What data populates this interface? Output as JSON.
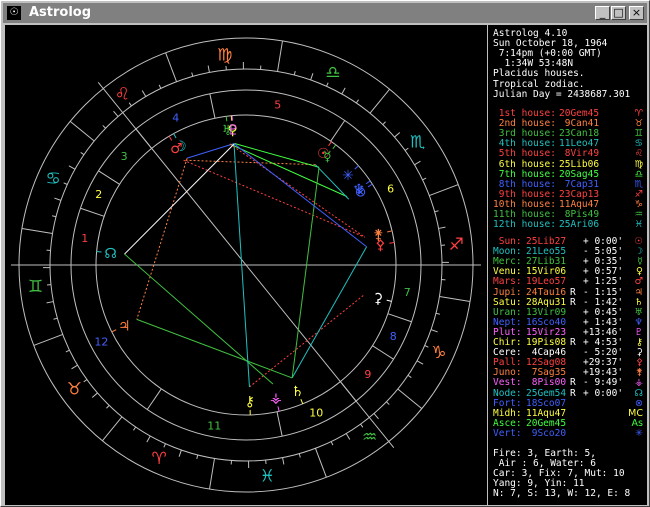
{
  "window": {
    "title": "Astrolog",
    "icon": "astrolog-app-icon",
    "controls": {
      "minimize": "_",
      "maximize": "□",
      "close": "×"
    }
  },
  "header": [
    "Astrolog 4.10",
    "Sun October 18, 1964",
    " 7:14pm (+0:00 GMT)",
    "  1:34W 53:48N",
    "Placidus houses.",
    "Tropical zodiac.",
    "Julian Day = 2438687.301"
  ],
  "houses": [
    {
      "label": "1st house:",
      "value": "20Gem45",
      "glyph": "♈",
      "color": "#ff4040"
    },
    {
      "label": "2nd house:",
      "value": "9Can41",
      "glyph": "♉",
      "color": "#ff8040"
    },
    {
      "label": "3rd house:",
      "value": "23Can18",
      "glyph": "♊",
      "color": "#40c040"
    },
    {
      "label": "4th house:",
      "value": "11Leo47",
      "glyph": "♋",
      "color": "#20c0c0"
    },
    {
      "label": "5th house:",
      "value": "8Vir49",
      "glyph": "♌",
      "color": "#ff4040"
    },
    {
      "label": "6th house:",
      "value": "25Lib06",
      "glyph": "♍",
      "color": "#ffff40"
    },
    {
      "label": "7th house:",
      "value": "20Sag45",
      "glyph": "♎",
      "color": "#40ff40"
    },
    {
      "label": "8th house:",
      "value": "7Cap31",
      "glyph": "♏",
      "color": "#4060ff"
    },
    {
      "label": "9th house:",
      "value": "23Cap13",
      "glyph": "♐",
      "color": "#ff4040"
    },
    {
      "label": "10th house:",
      "value": "11Aqu47",
      "glyph": "♑",
      "color": "#ff8040"
    },
    {
      "label": "11th house:",
      "value": "8Pis49",
      "glyph": "♒",
      "color": "#40c040"
    },
    {
      "label": "12th house:",
      "value": "25Ari06",
      "glyph": "♓",
      "color": "#20c0c0"
    }
  ],
  "planets": [
    {
      "name": "Sun:",
      "value": "25Lib27",
      "retro": " ",
      "offset": "+ 0:00'",
      "glyph": "☉",
      "color": "#ff4040"
    },
    {
      "name": "Moon:",
      "value": "21Leo55",
      "retro": " ",
      "offset": "- 5:05'",
      "glyph": "☽",
      "color": "#20c0c0"
    },
    {
      "name": "Merc:",
      "value": "27Lib31",
      "retro": " ",
      "offset": "+ 0:35'",
      "glyph": "☿",
      "color": "#40c040"
    },
    {
      "name": "Venu:",
      "value": "15Vir06",
      "retro": " ",
      "offset": "+ 0:57'",
      "glyph": "♀",
      "color": "#ffff40"
    },
    {
      "name": "Mars:",
      "value": "19Leo57",
      "retro": " ",
      "offset": "+ 1:25'",
      "glyph": "♂",
      "color": "#ff4040"
    },
    {
      "name": "Jupi:",
      "value": "24Tau16",
      "retro": "R",
      "offset": "- 1:15'",
      "glyph": "♃",
      "color": "#ff8040"
    },
    {
      "name": "Satu:",
      "value": "28Aqu31",
      "retro": "R",
      "offset": "- 1:42'",
      "glyph": "♄",
      "color": "#ffff40"
    },
    {
      "name": "Uran:",
      "value": "13Vir09",
      "retro": " ",
      "offset": "+ 0:45'",
      "glyph": "♅",
      "color": "#40c040"
    },
    {
      "name": "Nept:",
      "value": "16Sco40",
      "retro": " ",
      "offset": "+ 1:43'",
      "glyph": "♆",
      "color": "#4060ff"
    },
    {
      "name": "Plut:",
      "value": "15Vir23",
      "retro": " ",
      "offset": "+13:46'",
      "glyph": "♇",
      "color": "#ff60ff"
    },
    {
      "name": "Chir:",
      "value": "19Pis08",
      "retro": "R",
      "offset": "+ 4:53'",
      "glyph": "⚷",
      "color": "#ffff40"
    },
    {
      "name": "Cere:",
      "value": "4Cap46",
      "retro": " ",
      "offset": "- 5:20'",
      "glyph": "⚳",
      "color": "#ffffff"
    },
    {
      "name": "Pall:",
      "value": "12Sag08",
      "retro": " ",
      "offset": "+29:37'",
      "glyph": "⚴",
      "color": "#ff4040"
    },
    {
      "name": "Juno:",
      "value": "7Sag35",
      "retro": " ",
      "offset": "+19:43'",
      "glyph": "⚵",
      "color": "#ff8040"
    },
    {
      "name": "Vest:",
      "value": "8Pis00",
      "retro": "R",
      "offset": "- 9:49'",
      "glyph": "⚶",
      "color": "#ff60ff"
    },
    {
      "name": "Node:",
      "value": "25Gem54",
      "retro": "R",
      "offset": "+ 0:00'",
      "glyph": "☊",
      "color": "#20c0c0"
    },
    {
      "name": "Fort:",
      "value": "18Sco07",
      "retro": "",
      "offset": "",
      "glyph": "⊗",
      "color": "#4060ff"
    },
    {
      "name": "Midh:",
      "value": "11Aqu47",
      "retro": "",
      "offset": "",
      "glyph": "MC",
      "color": "#ffff40"
    },
    {
      "name": "Asce:",
      "value": "20Gem45",
      "retro": "",
      "offset": "",
      "glyph": "As",
      "color": "#40ff40"
    },
    {
      "name": "Vert:",
      "value": "9Sco20",
      "retro": "",
      "offset": "",
      "glyph": "✳",
      "color": "#4060ff"
    }
  ],
  "summary": [
    "Fire: 3, Earth: 5,",
    " Air : 6, Water: 6",
    "Car: 3, Fix: 7, Mut: 10",
    "Yang: 9, Yin: 11",
    "N: 7, S: 13, W: 12, E: 8"
  ],
  "chart": {
    "ascendant_deg": 80.75,
    "ring_signs": [
      "♈",
      "♉",
      "♊",
      "♋",
      "♌",
      "♍",
      "♎",
      "♏",
      "♐",
      "♑",
      "♒",
      "♓"
    ],
    "sign_colors": [
      "#ff4040",
      "#ff8040",
      "#40c040",
      "#20c0c0",
      "#ff4040",
      "#ff8040",
      "#40c040",
      "#20c0c0",
      "#ff4040",
      "#ff8040",
      "#40c040",
      "#20c0c0"
    ],
    "house_cusps_deg": [
      80.75,
      99.68,
      113.3,
      131.78,
      158.82,
      205.1,
      260.75,
      279.68,
      293.3,
      311.78,
      338.82,
      25.1
    ],
    "house_numbers": [
      "1",
      "2",
      "3",
      "4",
      "5",
      "6",
      "7",
      "8",
      "9",
      "10",
      "11",
      "12"
    ],
    "house_number_colors": [
      "#ff4040",
      "#ffff40",
      "#40c040",
      "#4060ff",
      "#ff4040",
      "#ffff40",
      "#40c040",
      "#4060ff",
      "#ff4040",
      "#ffff40",
      "#40c040",
      "#4060ff"
    ],
    "bodies": [
      {
        "glyph": "☉",
        "deg": 205.45,
        "color": "#ff4040"
      },
      {
        "glyph": "☽",
        "deg": 141.92,
        "color": "#20c0c0"
      },
      {
        "glyph": "☿",
        "deg": 207.52,
        "color": "#40c040"
      },
      {
        "glyph": "♀",
        "deg": 165.1,
        "color": "#ffff40"
      },
      {
        "glyph": "♂",
        "deg": 139.95,
        "color": "#ff4040"
      },
      {
        "glyph": "♃",
        "deg": 54.27,
        "color": "#ff8040"
      },
      {
        "glyph": "♄",
        "deg": 328.52,
        "color": "#ffff40"
      },
      {
        "glyph": "♅",
        "deg": 163.15,
        "color": "#40c040"
      },
      {
        "glyph": "♆",
        "deg": 226.67,
        "color": "#4060ff"
      },
      {
        "glyph": "♇",
        "deg": 165.38,
        "color": "#ff60ff"
      },
      {
        "glyph": "⚷",
        "deg": 349.13,
        "color": "#ffff40"
      },
      {
        "glyph": "⚳",
        "deg": 274.77,
        "color": "#ffffff"
      },
      {
        "glyph": "⚴",
        "deg": 252.13,
        "color": "#ff4040"
      },
      {
        "glyph": "⚵",
        "deg": 247.58,
        "color": "#ff8040"
      },
      {
        "glyph": "⚶",
        "deg": 338.0,
        "color": "#ff60ff"
      },
      {
        "glyph": "☊",
        "deg": 85.9,
        "color": "#20c0c0"
      },
      {
        "glyph": "⊗",
        "deg": 228.12,
        "color": "#4060ff"
      },
      {
        "glyph": "✳",
        "deg": 219.33,
        "color": "#4060ff"
      }
    ],
    "aspects": [
      {
        "a": 1,
        "b": 3,
        "color": "#4060ff"
      },
      {
        "a": 0,
        "b": 4,
        "color": "#ff8040"
      },
      {
        "a": 5,
        "b": 6,
        "color": "#40c040"
      },
      {
        "a": 7,
        "b": 8,
        "color": "#40ff40"
      },
      {
        "a": 2,
        "b": 9,
        "color": "#40ff40"
      },
      {
        "a": 10,
        "b": 11,
        "color": "#ff4040"
      },
      {
        "a": 6,
        "b": 12,
        "color": "#20c0c0"
      },
      {
        "a": 4,
        "b": 13,
        "color": "#ff4040"
      },
      {
        "a": 14,
        "b": 15,
        "color": "#40c040"
      },
      {
        "a": 0,
        "b": 16,
        "color": "#20c0c0"
      },
      {
        "a": 1,
        "b": 5,
        "color": "#ff8040"
      },
      {
        "a": 3,
        "b": 10,
        "color": "#20c0c0"
      },
      {
        "a": 7,
        "b": 13,
        "color": "#ff4040"
      },
      {
        "a": 15,
        "b": 9,
        "color": "#ffffff"
      },
      {
        "a": 2,
        "b": 6,
        "color": "#40c040"
      },
      {
        "a": 12,
        "b": 3,
        "color": "#4060ff"
      }
    ]
  }
}
